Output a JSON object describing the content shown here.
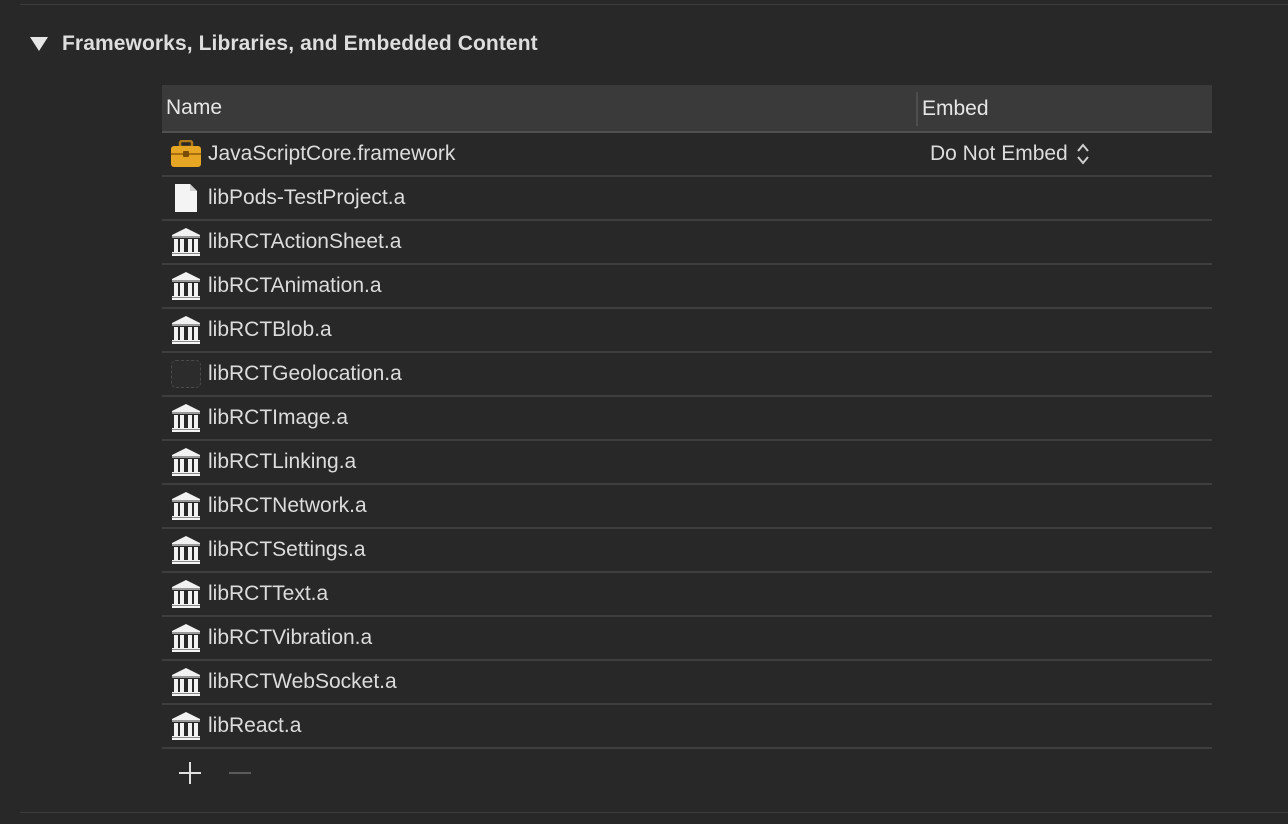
{
  "section": {
    "title": "Frameworks, Libraries, and Embedded Content"
  },
  "table": {
    "columns": {
      "name": "Name",
      "embed": "Embed"
    },
    "rows": [
      {
        "name": "JavaScriptCore.framework",
        "icon": "toolbox-icon",
        "embed": "Do Not Embed"
      },
      {
        "name": "libPods-TestProject.a",
        "icon": "document-icon",
        "embed": ""
      },
      {
        "name": "libRCTActionSheet.a",
        "icon": "library-icon",
        "embed": ""
      },
      {
        "name": "libRCTAnimation.a",
        "icon": "library-icon",
        "embed": ""
      },
      {
        "name": "libRCTBlob.a",
        "icon": "library-icon",
        "embed": ""
      },
      {
        "name": "libRCTGeolocation.a",
        "icon": "placeholder-icon",
        "embed": ""
      },
      {
        "name": "libRCTImage.a",
        "icon": "library-icon",
        "embed": ""
      },
      {
        "name": "libRCTLinking.a",
        "icon": "library-icon",
        "embed": ""
      },
      {
        "name": "libRCTNetwork.a",
        "icon": "library-icon",
        "embed": ""
      },
      {
        "name": "libRCTSettings.a",
        "icon": "library-icon",
        "embed": ""
      },
      {
        "name": "libRCTText.a",
        "icon": "library-icon",
        "embed": ""
      },
      {
        "name": "libRCTVibration.a",
        "icon": "library-icon",
        "embed": ""
      },
      {
        "name": "libRCTWebSocket.a",
        "icon": "library-icon",
        "embed": ""
      },
      {
        "name": "libReact.a",
        "icon": "library-icon",
        "embed": ""
      }
    ]
  },
  "footer": {
    "add_icon": "plus-icon",
    "remove_icon": "minus-icon"
  },
  "colors": {
    "background": "#282828",
    "header_background": "#3a3a3a",
    "text": "#dcdcdc",
    "toolbox": "#e0a020"
  }
}
